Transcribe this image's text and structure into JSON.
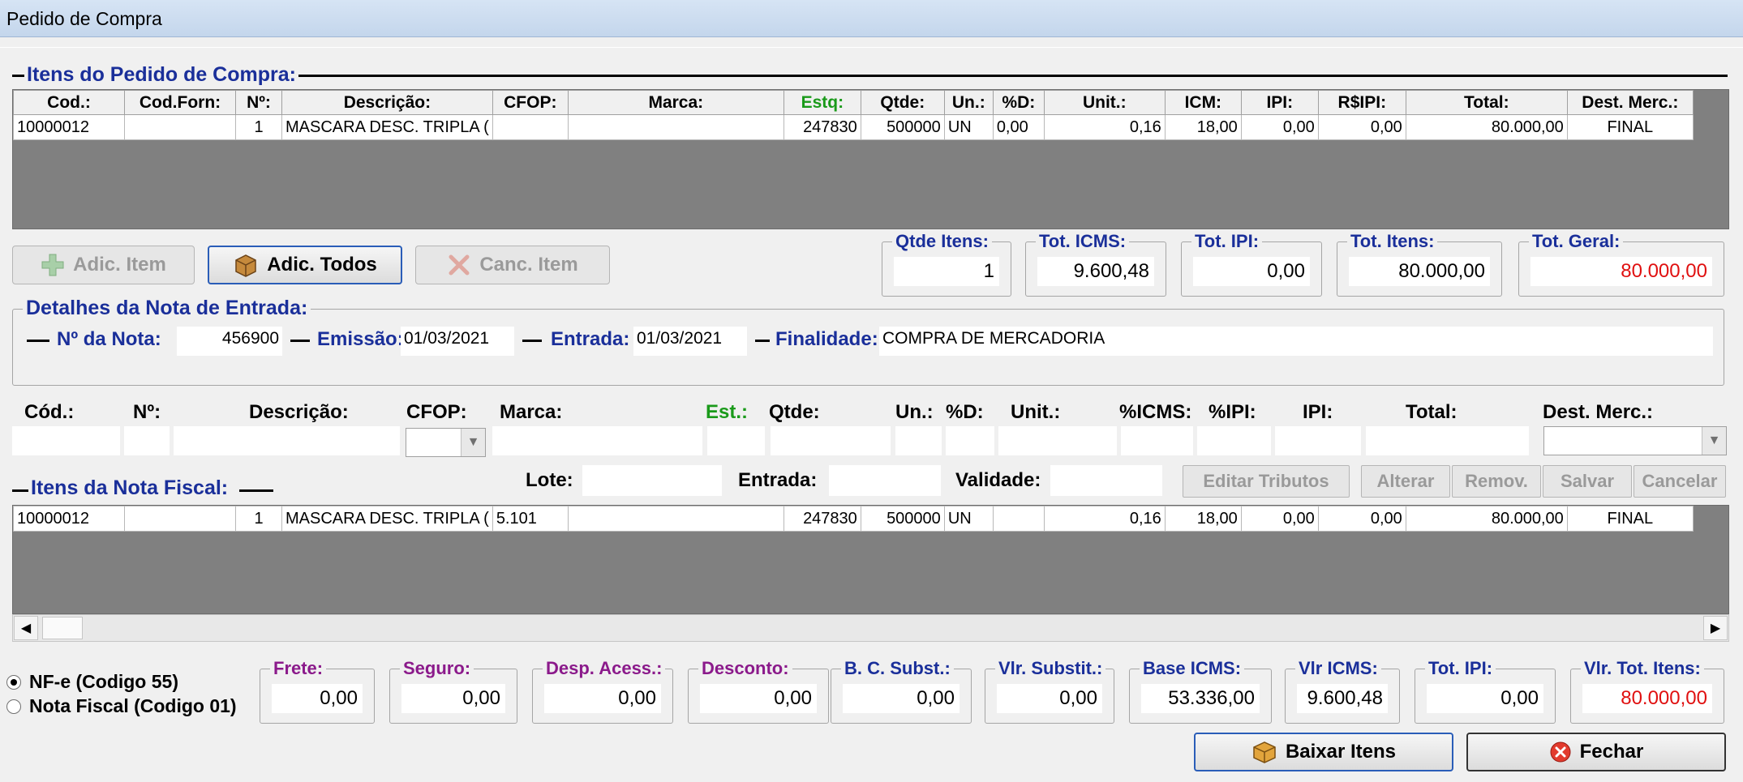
{
  "window": {
    "title": "Pedido de Compra"
  },
  "order_section": {
    "title": "Itens do Pedido de Compra:"
  },
  "order_grid": {
    "columns": [
      "Cod.:",
      "Cod.Forn:",
      "Nº:",
      "Descrição:",
      "CFOP:",
      "Marca:",
      "Estq:",
      "Qtde:",
      "Un.:",
      "%D:",
      "Unit.:",
      "ICM:",
      "IPI:",
      "R$IPI:",
      "Total:",
      "Dest. Merc.:"
    ],
    "rows": [
      [
        "10000012",
        "",
        "1",
        "MASCARA DESC. TRIPLA (",
        "",
        "",
        "247830",
        "500000",
        "UN",
        "0,00",
        "0,16",
        "18,00",
        "0,00",
        "0,00",
        "80.000,00",
        "FINAL"
      ]
    ]
  },
  "order_buttons": {
    "add_item": "Adic. Item",
    "add_all": "Adic. Todos",
    "cancel_item": "Canc. Item"
  },
  "totals": {
    "qtde_itens_label": "Qtde Itens:",
    "qtde_itens": "1",
    "tot_icms_label": "Tot. ICMS:",
    "tot_icms": "9.600,48",
    "tot_ipi_label": "Tot. IPI:",
    "tot_ipi": "0,00",
    "tot_itens_label": "Tot. Itens:",
    "tot_itens": "80.000,00",
    "tot_geral_label": "Tot. Geral:",
    "tot_geral": "80.000,00"
  },
  "nota_details": {
    "title": "Detalhes da Nota de Entrada:",
    "numero_label": "Nº da Nota:",
    "numero": "456900",
    "emissao_label": "Emissão:",
    "emissao": "01/03/2021",
    "entrada_label": "Entrada:",
    "entrada": "01/03/2021",
    "finalidade_label": "Finalidade:",
    "finalidade": "COMPRA DE MERCADORIA"
  },
  "edit_row": {
    "labels": {
      "cod": "Cód.:",
      "num": "Nº:",
      "desc": "Descrição:",
      "cfop": "CFOP:",
      "marca": "Marca:",
      "est": "Est.:",
      "qtde": "Qtde:",
      "un": "Un.:",
      "d": "%D:",
      "unit": "Unit.:",
      "icms": "%ICMS:",
      "ipi_pct": "%IPI:",
      "ipi": "IPI:",
      "total": "Total:",
      "dest": "Dest. Merc.:"
    },
    "lote_label": "Lote:",
    "entrada_label": "Entrada:",
    "validade_label": "Validade:"
  },
  "edit_buttons": {
    "editar_tributos": "Editar Tributos",
    "alterar": "Alterar",
    "remov": "Remov.",
    "salvar": "Salvar",
    "cancelar": "Cancelar"
  },
  "nota_section": {
    "title": "Itens da Nota Fiscal:"
  },
  "nota_grid": {
    "rows": [
      [
        "10000012",
        "",
        "1",
        "MASCARA DESC. TRIPLA (",
        "5.101",
        "",
        "247830",
        "500000",
        "UN",
        "",
        "0,16",
        "18,00",
        "0,00",
        "0,00",
        "80.000,00",
        "FINAL"
      ]
    ]
  },
  "doc_type": {
    "nfe": "NF-e (Codigo 55)",
    "nf": "Nota Fiscal (Codigo 01)",
    "selected": "NF-e (Codigo 55)"
  },
  "footer_totals": {
    "frete_label": "Frete:",
    "frete": "0,00",
    "seguro_label": "Seguro:",
    "seguro": "0,00",
    "desp_label": "Desp. Acess.:",
    "desp": "0,00",
    "desconto_label": "Desconto:",
    "desconto": "0,00",
    "bc_label": "B. C. Subst.:",
    "bc": "0,00",
    "vlr_subst_label": "Vlr. Substit.:",
    "vlr_subst": "0,00",
    "base_icms_label": "Base ICMS:",
    "base_icms": "53.336,00",
    "vlr_icms_label": "Vlr ICMS:",
    "vlr_icms": "9.600,48",
    "tot_ipi_label": "Tot. IPI:",
    "tot_ipi": "0,00",
    "vlr_tot_label": "Vlr. Tot. Itens:",
    "vlr_tot": "80.000,00"
  },
  "footer_buttons": {
    "baixar": "Baixar Itens",
    "fechar": "Fechar"
  },
  "colors": {
    "label_blue": "#1a2f9a",
    "purple": "#8b1a8b",
    "red": "#e01010",
    "green": "#1a9a1a"
  }
}
